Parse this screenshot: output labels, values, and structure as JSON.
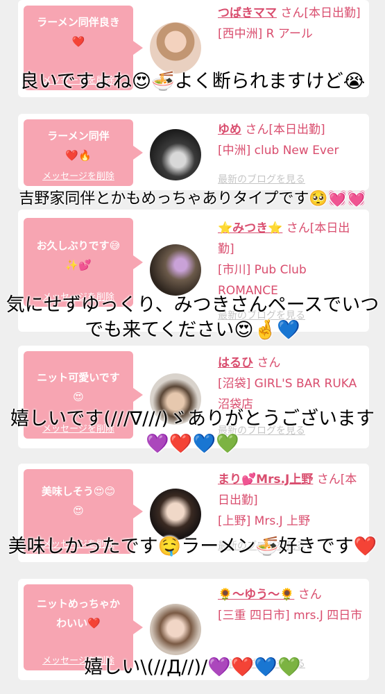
{
  "colors": {
    "accent": "#d94d6e",
    "bubble": "#f7a5b2",
    "muted": "#c6c6c6"
  },
  "delete_label": "メッセージを削除",
  "blog_label": "最新のブログを見る",
  "messages": [
    {
      "bubble_text": "ラーメン同伴良き\n❤️",
      "name": "つばきママ",
      "status": "さん[本日出勤]",
      "shop": "[西中洲] R アール",
      "caption": "良いですよね😍🍜よく断られますけど😭"
    },
    {
      "bubble_text": "ラーメン同伴\n❤️🔥",
      "name": "ゆめ",
      "status": "さん[本日出勤]",
      "shop": "[中洲] club New Ever",
      "caption": "吉野家同伴とかもめっちゃありタイプです🥺💓💓"
    },
    {
      "bubble_text": "お久しぶりです😅\n✨💕",
      "name": "⭐みつき⭐",
      "status": "さん[本日出勤]",
      "shop": "[市川] Pub Club ROMANCE",
      "caption": "気にせずゆっくり、みつきさんペースでいつでも来てください😍🤞💙"
    },
    {
      "bubble_text": "ニット可愛いです\n😍",
      "name": "はるひ",
      "status": "さん",
      "shop": "[沼袋] GIRL'S BAR RUKA　沼袋店",
      "caption": "嬉しいです(///∇///)ゞありがとうございます💜❤️💙💚"
    },
    {
      "bubble_text": "美味しそう😍😊\n😍",
      "name": "まり💕Mrs.J上野",
      "status": "さん[本日出勤]",
      "shop": "[上野] Mrs.J 上野",
      "caption": "美味しかったです🤤ラーメン🍜好きです❤️"
    },
    {
      "bubble_text": "ニットめっちゃか\nわいい❤️",
      "name": "🌻〜ゆう〜🌻",
      "status": "さん",
      "shop": "[三重 四日市] mrs.J 四日市",
      "caption": "嬉しい\\(//Д//)/💜❤️💙💚"
    }
  ]
}
